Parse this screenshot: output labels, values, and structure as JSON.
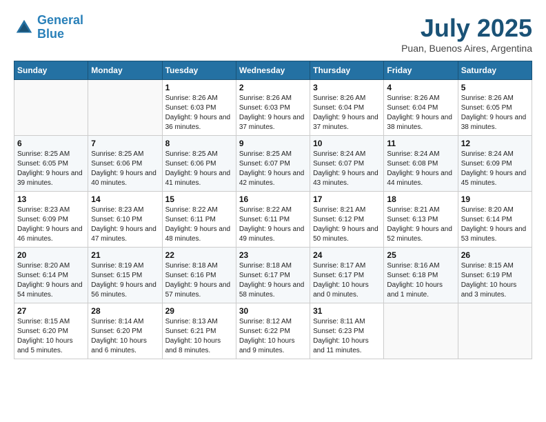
{
  "logo": {
    "line1": "General",
    "line2": "Blue"
  },
  "title": "July 2025",
  "location": "Puan, Buenos Aires, Argentina",
  "days_of_week": [
    "Sunday",
    "Monday",
    "Tuesday",
    "Wednesday",
    "Thursday",
    "Friday",
    "Saturday"
  ],
  "weeks": [
    [
      {
        "day": "",
        "sunrise": "",
        "sunset": "",
        "daylight": ""
      },
      {
        "day": "",
        "sunrise": "",
        "sunset": "",
        "daylight": ""
      },
      {
        "day": "1",
        "sunrise": "Sunrise: 8:26 AM",
        "sunset": "Sunset: 6:03 PM",
        "daylight": "Daylight: 9 hours and 36 minutes."
      },
      {
        "day": "2",
        "sunrise": "Sunrise: 8:26 AM",
        "sunset": "Sunset: 6:03 PM",
        "daylight": "Daylight: 9 hours and 37 minutes."
      },
      {
        "day": "3",
        "sunrise": "Sunrise: 8:26 AM",
        "sunset": "Sunset: 6:04 PM",
        "daylight": "Daylight: 9 hours and 37 minutes."
      },
      {
        "day": "4",
        "sunrise": "Sunrise: 8:26 AM",
        "sunset": "Sunset: 6:04 PM",
        "daylight": "Daylight: 9 hours and 38 minutes."
      },
      {
        "day": "5",
        "sunrise": "Sunrise: 8:26 AM",
        "sunset": "Sunset: 6:05 PM",
        "daylight": "Daylight: 9 hours and 38 minutes."
      }
    ],
    [
      {
        "day": "6",
        "sunrise": "Sunrise: 8:25 AM",
        "sunset": "Sunset: 6:05 PM",
        "daylight": "Daylight: 9 hours and 39 minutes."
      },
      {
        "day": "7",
        "sunrise": "Sunrise: 8:25 AM",
        "sunset": "Sunset: 6:06 PM",
        "daylight": "Daylight: 9 hours and 40 minutes."
      },
      {
        "day": "8",
        "sunrise": "Sunrise: 8:25 AM",
        "sunset": "Sunset: 6:06 PM",
        "daylight": "Daylight: 9 hours and 41 minutes."
      },
      {
        "day": "9",
        "sunrise": "Sunrise: 8:25 AM",
        "sunset": "Sunset: 6:07 PM",
        "daylight": "Daylight: 9 hours and 42 minutes."
      },
      {
        "day": "10",
        "sunrise": "Sunrise: 8:24 AM",
        "sunset": "Sunset: 6:07 PM",
        "daylight": "Daylight: 9 hours and 43 minutes."
      },
      {
        "day": "11",
        "sunrise": "Sunrise: 8:24 AM",
        "sunset": "Sunset: 6:08 PM",
        "daylight": "Daylight: 9 hours and 44 minutes."
      },
      {
        "day": "12",
        "sunrise": "Sunrise: 8:24 AM",
        "sunset": "Sunset: 6:09 PM",
        "daylight": "Daylight: 9 hours and 45 minutes."
      }
    ],
    [
      {
        "day": "13",
        "sunrise": "Sunrise: 8:23 AM",
        "sunset": "Sunset: 6:09 PM",
        "daylight": "Daylight: 9 hours and 46 minutes."
      },
      {
        "day": "14",
        "sunrise": "Sunrise: 8:23 AM",
        "sunset": "Sunset: 6:10 PM",
        "daylight": "Daylight: 9 hours and 47 minutes."
      },
      {
        "day": "15",
        "sunrise": "Sunrise: 8:22 AM",
        "sunset": "Sunset: 6:11 PM",
        "daylight": "Daylight: 9 hours and 48 minutes."
      },
      {
        "day": "16",
        "sunrise": "Sunrise: 8:22 AM",
        "sunset": "Sunset: 6:11 PM",
        "daylight": "Daylight: 9 hours and 49 minutes."
      },
      {
        "day": "17",
        "sunrise": "Sunrise: 8:21 AM",
        "sunset": "Sunset: 6:12 PM",
        "daylight": "Daylight: 9 hours and 50 minutes."
      },
      {
        "day": "18",
        "sunrise": "Sunrise: 8:21 AM",
        "sunset": "Sunset: 6:13 PM",
        "daylight": "Daylight: 9 hours and 52 minutes."
      },
      {
        "day": "19",
        "sunrise": "Sunrise: 8:20 AM",
        "sunset": "Sunset: 6:14 PM",
        "daylight": "Daylight: 9 hours and 53 minutes."
      }
    ],
    [
      {
        "day": "20",
        "sunrise": "Sunrise: 8:20 AM",
        "sunset": "Sunset: 6:14 PM",
        "daylight": "Daylight: 9 hours and 54 minutes."
      },
      {
        "day": "21",
        "sunrise": "Sunrise: 8:19 AM",
        "sunset": "Sunset: 6:15 PM",
        "daylight": "Daylight: 9 hours and 56 minutes."
      },
      {
        "day": "22",
        "sunrise": "Sunrise: 8:18 AM",
        "sunset": "Sunset: 6:16 PM",
        "daylight": "Daylight: 9 hours and 57 minutes."
      },
      {
        "day": "23",
        "sunrise": "Sunrise: 8:18 AM",
        "sunset": "Sunset: 6:17 PM",
        "daylight": "Daylight: 9 hours and 58 minutes."
      },
      {
        "day": "24",
        "sunrise": "Sunrise: 8:17 AM",
        "sunset": "Sunset: 6:17 PM",
        "daylight": "Daylight: 10 hours and 0 minutes."
      },
      {
        "day": "25",
        "sunrise": "Sunrise: 8:16 AM",
        "sunset": "Sunset: 6:18 PM",
        "daylight": "Daylight: 10 hours and 1 minute."
      },
      {
        "day": "26",
        "sunrise": "Sunrise: 8:15 AM",
        "sunset": "Sunset: 6:19 PM",
        "daylight": "Daylight: 10 hours and 3 minutes."
      }
    ],
    [
      {
        "day": "27",
        "sunrise": "Sunrise: 8:15 AM",
        "sunset": "Sunset: 6:20 PM",
        "daylight": "Daylight: 10 hours and 5 minutes."
      },
      {
        "day": "28",
        "sunrise": "Sunrise: 8:14 AM",
        "sunset": "Sunset: 6:20 PM",
        "daylight": "Daylight: 10 hours and 6 minutes."
      },
      {
        "day": "29",
        "sunrise": "Sunrise: 8:13 AM",
        "sunset": "Sunset: 6:21 PM",
        "daylight": "Daylight: 10 hours and 8 minutes."
      },
      {
        "day": "30",
        "sunrise": "Sunrise: 8:12 AM",
        "sunset": "Sunset: 6:22 PM",
        "daylight": "Daylight: 10 hours and 9 minutes."
      },
      {
        "day": "31",
        "sunrise": "Sunrise: 8:11 AM",
        "sunset": "Sunset: 6:23 PM",
        "daylight": "Daylight: 10 hours and 11 minutes."
      },
      {
        "day": "",
        "sunrise": "",
        "sunset": "",
        "daylight": ""
      },
      {
        "day": "",
        "sunrise": "",
        "sunset": "",
        "daylight": ""
      }
    ]
  ]
}
